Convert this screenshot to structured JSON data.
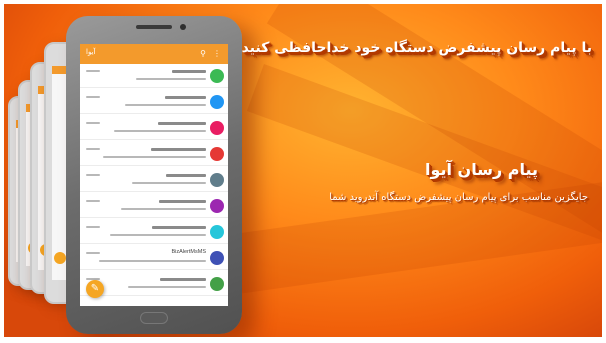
{
  "headline": "با پیام رسان پیشفرض دستگاه خود خداحافظی کنید",
  "product_name": "پیام رسان آیوا",
  "tagline": "جایگزین مناسب برای پیام رسان پیشفرض دستگاه آندروید شما",
  "app": {
    "title": "آیوا",
    "search_icon": "search-icon",
    "menu_icon": "overflow-menu-icon",
    "fab_icon": "compose-icon",
    "messages": [
      {
        "sender": "",
        "color": "#3cba54"
      },
      {
        "sender": "",
        "color": "#2196f3"
      },
      {
        "sender": "",
        "color": "#e91e63"
      },
      {
        "sender": "",
        "color": "#e53935"
      },
      {
        "sender": "",
        "color": "#607d8b"
      },
      {
        "sender": "",
        "color": "#9c27b0"
      },
      {
        "sender": "",
        "color": "#26c6da"
      },
      {
        "sender": "BizAlertMsMS",
        "color": "#3f51b5"
      },
      {
        "sender": "",
        "color": "#43a047"
      }
    ]
  },
  "colors": {
    "accent": "#f39a2c",
    "background": "#ff8a1a",
    "text_shadow": "#b23a00"
  }
}
